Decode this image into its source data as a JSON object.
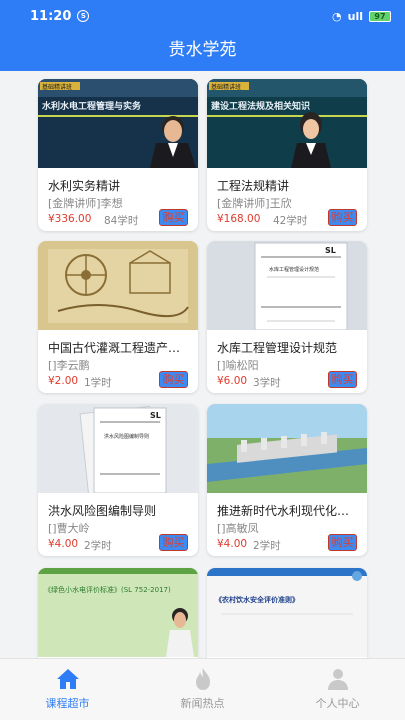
{
  "status": {
    "time": "11:20",
    "notif": "S",
    "signal": "ull",
    "battery": "97"
  },
  "app": {
    "title": "贵水学苑"
  },
  "courses": [
    {
      "title": "水利实务精讲",
      "teacher": "[金牌讲师]李想",
      "price": "¥336.00",
      "hours": "84学时",
      "buy": "购买",
      "thumb_text": "水利水电工程管理与实务"
    },
    {
      "title": "工程法规精讲",
      "teacher": "[金牌讲师]王欣",
      "price": "¥168.00",
      "hours": "42学时",
      "buy": "购买",
      "thumb_text": "建设工程法规及相关知识"
    },
    {
      "title": "中国古代灌溉工程遗产…",
      "teacher": "[]李云鹏",
      "price": "¥2.00",
      "hours": "1学时",
      "buy": "购买",
      "thumb_text": ""
    },
    {
      "title": "水库工程管理设计规范",
      "teacher": "[]喻松阳",
      "price": "¥6.00",
      "hours": "3学时",
      "buy": "购买",
      "thumb_text": "水库工程管理设计规范"
    },
    {
      "title": "洪水风险图编制导则",
      "teacher": "[]曹大岭",
      "price": "¥4.00",
      "hours": "2学时",
      "buy": "购买",
      "thumb_text": "洪水风险图编制导则"
    },
    {
      "title": "推进新时代水利现代化…",
      "teacher": "[]高敏凤",
      "price": "¥4.00",
      "hours": "2学时",
      "buy": "购买",
      "thumb_text": ""
    },
    {
      "title": "",
      "teacher": "",
      "price": "",
      "hours": "",
      "buy": "",
      "thumb_text": "《绿色小水电评价标准》(SL 752-2017)"
    },
    {
      "title": "",
      "teacher": "",
      "price": "",
      "hours": "",
      "buy": "",
      "thumb_text": "《农村饮水安全评价准则》"
    }
  ],
  "tabs": [
    {
      "label": "课程超市",
      "icon": "home-icon"
    },
    {
      "label": "新闻热点",
      "icon": "flame-icon"
    },
    {
      "label": "个人中心",
      "icon": "person-icon"
    }
  ],
  "colors": {
    "primary": "#2f7df6",
    "price": "#e03b2d"
  }
}
